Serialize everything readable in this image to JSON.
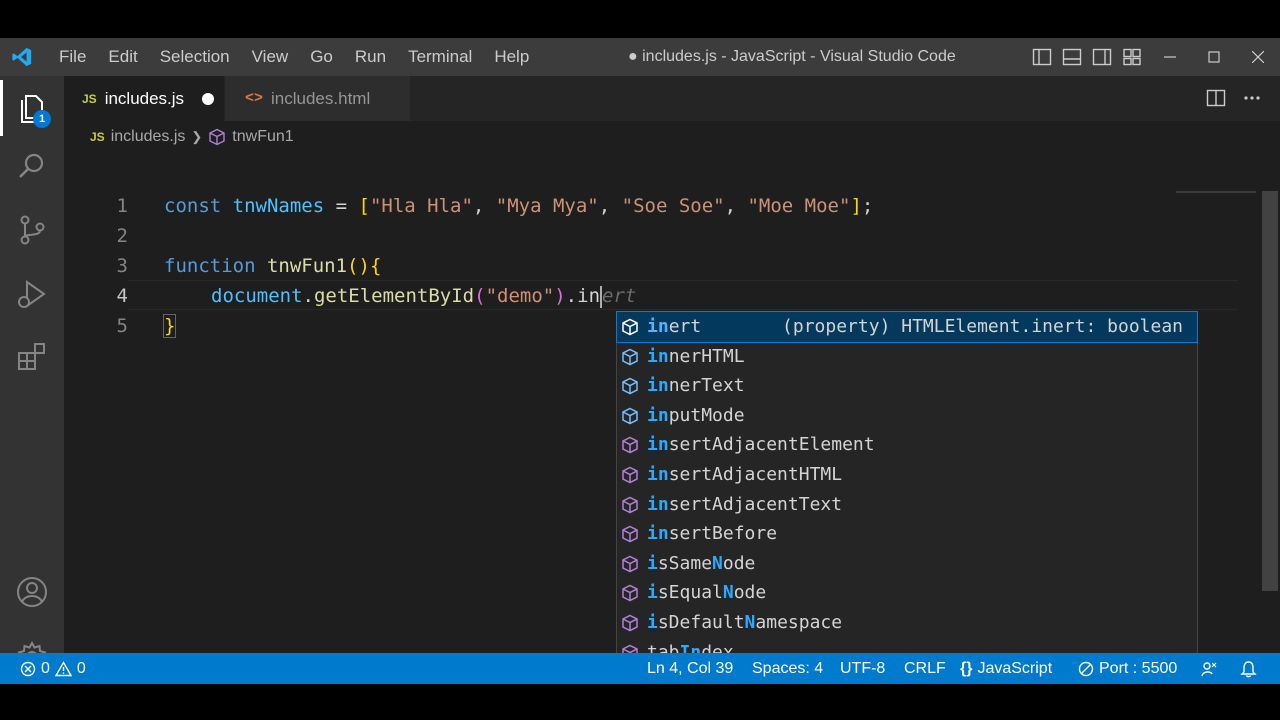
{
  "window": {
    "title": "● includes.js - JavaScript - Visual Studio Code",
    "menu": [
      "File",
      "Edit",
      "Selection",
      "View",
      "Go",
      "Run",
      "Terminal",
      "Help"
    ]
  },
  "activity_bar": {
    "items": [
      "files-icon",
      "search-icon",
      "source-control-icon",
      "run-debug-icon",
      "extensions-icon"
    ],
    "bottom": [
      "account-icon",
      "gear-icon"
    ],
    "explorer_badge": "1"
  },
  "tabs": [
    {
      "icon": "JS",
      "label": "includes.js",
      "active": true,
      "dirty": true
    },
    {
      "icon": "<>",
      "label": "includes.html",
      "active": false
    }
  ],
  "breadcrumb": {
    "file": "includes.js",
    "symbol": "tnwFun1"
  },
  "editor": {
    "line_numbers": [
      "1",
      "2",
      "3",
      "4",
      "5"
    ],
    "current_line": 4,
    "lines": {
      "l1": {
        "kw": "const",
        "name": "tnwNames",
        "eq": " = ",
        "open": "[",
        "s1": "\"Hla Hla\"",
        "s2": "\"Mya Mya\"",
        "s3": "\"Soe Soe\"",
        "s4": "\"Moe Moe\"",
        "sep": ", ",
        "close": "]",
        "end": ";"
      },
      "l3": {
        "kw": "function",
        "name": "tnwFun1",
        "parens": "()",
        "brace": "{"
      },
      "l4": {
        "obj": "document",
        "dot1": ".",
        "method": "getElementById",
        "popen": "(",
        "arg": "\"demo\"",
        "pclose": ")",
        "dot2": ".",
        "typed": "in",
        "ghost": "ert"
      },
      "l5": {
        "brace": "}"
      }
    }
  },
  "suggestions": [
    {
      "pre": "",
      "hl": "in",
      "post": "ert",
      "detail": "(property) HTMLElement.inert: boolean",
      "selected": true
    },
    {
      "pre": "",
      "hl": "in",
      "post": "nerHTML"
    },
    {
      "pre": "",
      "hl": "in",
      "post": "nerText"
    },
    {
      "pre": "",
      "hl": "in",
      "post": "putMode"
    },
    {
      "pre": "",
      "hl": "in",
      "post": "sertAdjacentElement"
    },
    {
      "pre": "",
      "hl": "in",
      "post": "sertAdjacentHTML"
    },
    {
      "pre": "",
      "hl": "in",
      "post": "sertAdjacentText"
    },
    {
      "pre": "",
      "hl": "in",
      "post": "sertBefore"
    },
    {
      "pre": "",
      "hl": "i",
      "mid": "sSame",
      "hl2": "N",
      "post": "ode"
    },
    {
      "pre": "",
      "hl": "i",
      "mid": "sEqual",
      "hl2": "N",
      "post": "ode"
    },
    {
      "pre": "",
      "hl": "i",
      "mid": "sDefault",
      "hl2": "N",
      "post": "amespace"
    },
    {
      "pre": "tab",
      "hl": "In",
      "post": "dex"
    }
  ],
  "status_bar": {
    "errors": "0",
    "warnings": "0",
    "position": "Ln 4, Col 39",
    "spaces": "Spaces: 4",
    "encoding": "UTF-8",
    "eol": "CRLF",
    "language": "JavaScript",
    "port": "Port : 5500"
  },
  "colors": {
    "accent": "#007acc",
    "selection": "#04395e",
    "highlight": "#2aaaff"
  }
}
